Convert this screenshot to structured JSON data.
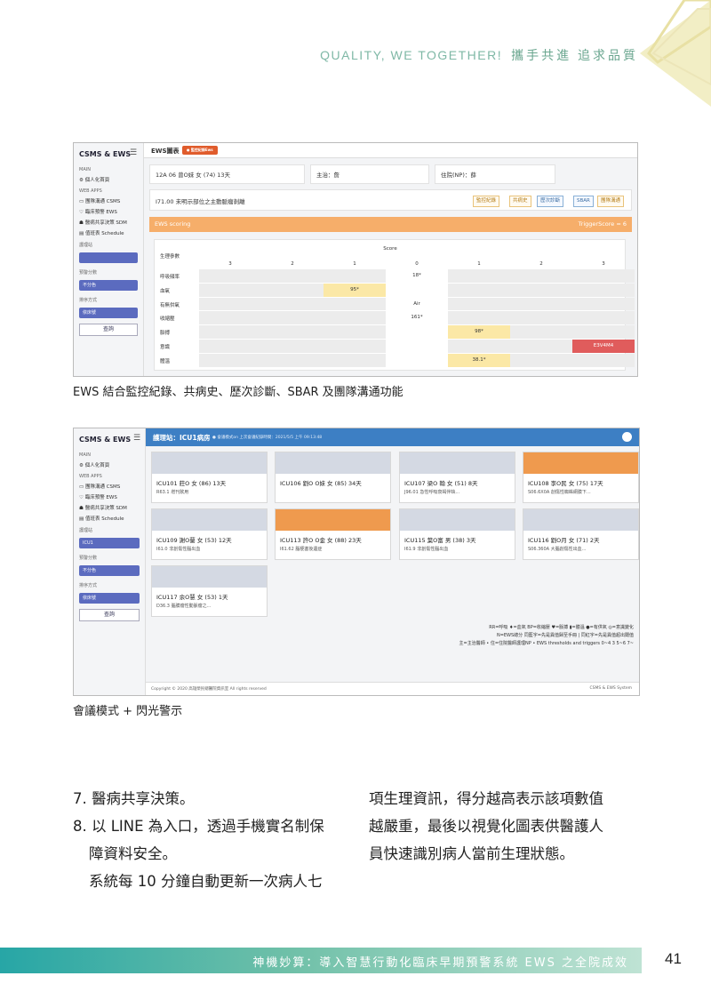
{
  "header": {
    "en": "QUALITY, WE TOGETHER!",
    "zh": "攜手共進 追求品質"
  },
  "screenshot1": {
    "brand": "CSMS & EWS",
    "sidebar": {
      "main_label": "MAIN",
      "home": "個人化首頁",
      "webapps_label": "WEB APPS",
      "apps": [
        "團隊溝通 CSMS",
        "臨床預警 EWS",
        "醫病共享決策 SDM",
        "值班表 Schedule"
      ],
      "ward_label": "護理站",
      "score_label": "預警分數",
      "score_value": "不分色",
      "sort_label": "排序方式",
      "sort_value": "依床號",
      "query_button": "查詢"
    },
    "title": "EWS圖表",
    "badge": "● 監控紀錄Ews",
    "patient": {
      "bed": "12A 06 曾O妹 女 (74) 13天",
      "attending": "主治：詹",
      "resident": "住院(NP)：薛"
    },
    "diagnosis": "I71.00 未明示部位之主動脈瘤剝離",
    "tabs": [
      "監控紀錄",
      "共病史",
      "歷次診斷",
      "SBAR",
      "團隊溝通"
    ],
    "scoring_label": "EWS scoring",
    "trigger": "TriggerScore = 6",
    "table": {
      "param_header": "生理參數",
      "score_header": "Score",
      "score_cols": [
        "3",
        "2",
        "1",
        "0",
        "1",
        "2",
        "3"
      ],
      "rows": [
        "呼吸頻率",
        "血氧",
        "有無供氧",
        "收縮壓",
        "脈搏",
        "意識",
        "體溫"
      ],
      "cells": [
        {
          "row": 0,
          "col": 3,
          "text": "18*"
        },
        {
          "row": 1,
          "col": 2,
          "text": "95*"
        },
        {
          "row": 2,
          "col": 3,
          "text": "Air"
        },
        {
          "row": 3,
          "col": 3,
          "text": "161*"
        },
        {
          "row": 4,
          "col": 4,
          "text": "98*"
        },
        {
          "row": 5,
          "col": 6,
          "text": "E3V4M4"
        },
        {
          "row": 6,
          "col": 4,
          "text": "38.1*"
        }
      ]
    }
  },
  "caption1": "EWS 結合監控紀錄、共病史、歷次診斷、SBAR 及團隊溝通功能",
  "screenshot2": {
    "brand": "CSMS & EWS",
    "sidebar": {
      "main_label": "MAIN",
      "home": "個人化首頁",
      "webapps_label": "WEB APPS",
      "apps": [
        "團隊溝通 CSMS",
        "臨床預警 EWS",
        "醫病共享決策 SDM",
        "值班表 Schedule"
      ],
      "ward_label": "護理站",
      "ward_value": "ICU1",
      "score_label": "預警分數",
      "score_value": "不分色",
      "sort_label": "排序方式",
      "sort_value": "依床號",
      "query_button": "查詢"
    },
    "ward": "護理站：ICU1病房",
    "sub": "● 會議模式on   上次會議紀錄時間：2021/5/5 上午 09:13:48",
    "cards": [
      {
        "name": "ICU101 莊O 女 (86) 13天",
        "dx": "R63.1 增刊飲用",
        "orange": false
      },
      {
        "name": "ICU106 劉O O妹 女 (85) 34天",
        "dx": "",
        "orange": false
      },
      {
        "name": "ICU107 梁O 翰 女 (51) 8天",
        "dx": "J96.01 急性呼吸衰竭伴缺...",
        "orange": false
      },
      {
        "name": "ICU108 李O民 女 (75) 17天",
        "dx": "S06.6X0A 創傷性蜘蛛網膜下...",
        "orange": true
      },
      {
        "name": "ICU109 謝O蘭 女 (53) 12天",
        "dx": "I61.0 非創傷性腦出血",
        "orange": false
      },
      {
        "name": "ICU113 許O O金 女 (88) 23天",
        "dx": "I61.62 腦梗塞後遺症",
        "orange": true
      },
      {
        "name": "ICU115 葉O富 男 (38) 3天",
        "dx": "I61.9 非創傷性腦出血",
        "orange": false
      },
      {
        "name": "ICU116 劉O月 女 (71) 2天",
        "dx": "S06.360A 大腦創傷性出血...",
        "orange": false
      },
      {
        "name": "ICU117 余O慧 女 (53) 1天",
        "dx": "D36.3 腦膜瘤性動脈瘤之...",
        "orange": false
      }
    ],
    "legend": [
      "RR=呼吸 ♦=血氧 BP=收縮壓 ♥=脈搏 ▮=體溫 ●=有供氧 ◎=意識變化",
      "N=EWS總分 同藍字=先是異值歸至手冊 | 同紅字=先是異值超出閾值",
      "主=主治醫師 • 住=住院醫師護理NP • EWS thresholds and triggers  0~4  3  5~6  7~"
    ],
    "footer": "Copyright © 2020 高雄榮民總醫院資訊室 All rights reserved",
    "footer_right": "CSMS & EWS System"
  },
  "caption2": "會議模式 + 閃光警示",
  "body": {
    "left": [
      "7. 醫病共享決策。",
      "8. 以 LINE 為入口，透過手機實名制保",
      "障資料安全。",
      "系統每 10 分鐘自動更新一次病人七"
    ],
    "right": [
      "項生理資訊，得分越高表示該項數值",
      "越嚴重，最後以視覺化圖表供醫護人",
      "員快速識別病人當前生理狀態。"
    ]
  },
  "footer": {
    "band": "神機妙算：導入智慧行動化臨床早期預警系統 EWS 之全院成效",
    "page": "41"
  },
  "colors": {
    "teal": "#27a6a6",
    "orange": "#f6ae6a",
    "blue": "#3d7fc4",
    "alert": "#e05c5c",
    "highlight": "#fbe8a6"
  }
}
